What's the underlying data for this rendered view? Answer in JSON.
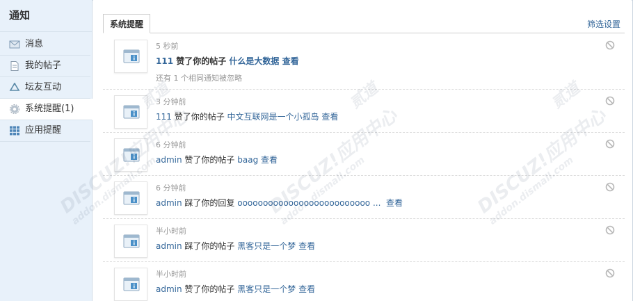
{
  "sidebar": {
    "title": "通知",
    "items": [
      {
        "label": "消息",
        "icon": "envelope-icon",
        "active": false
      },
      {
        "label": "我的帖子",
        "icon": "document-icon",
        "active": false
      },
      {
        "label": "坛友互动",
        "icon": "recycle-icon",
        "active": false
      },
      {
        "label": "系统提醒(1)",
        "icon": "gear-icon",
        "active": true
      },
      {
        "label": "应用提醒",
        "icon": "grid-icon",
        "active": false
      }
    ]
  },
  "main": {
    "tab_label": "系统提醒",
    "filter_label": "筛选设置"
  },
  "notices": [
    {
      "time": "5 秒前",
      "actor": "111",
      "action": " 赞了你的帖子 ",
      "target": "什么是大数据",
      "view": "查看",
      "extra": "还有 1 个相同通知被忽略"
    },
    {
      "time": "3 分钟前",
      "actor": "111",
      "action": " 赞了你的帖子 ",
      "target": "中文互联网是一个小孤岛",
      "view": "查看"
    },
    {
      "time": "6 分钟前",
      "actor": "admin",
      "action": " 赞了你的帖子 ",
      "target": "baag",
      "view": "查看"
    },
    {
      "time": "6 分钟前",
      "actor": "admin",
      "action": " 踩了你的回复 ",
      "target": "oooooooooooooooooooooooooo ...",
      "view": "查看"
    },
    {
      "time": "半小时前",
      "actor": "admin",
      "action": " 踩了你的帖子 ",
      "target": "黑客只是一个梦",
      "view": "查看"
    },
    {
      "time": "半小时前",
      "actor": "admin",
      "action": " 赞了你的帖子 ",
      "target": "黑客只是一个梦",
      "view": "查看"
    }
  ],
  "watermark": {
    "brand": "DISCUZ!应用中心",
    "sub": "addon.dismall.com",
    "mark": "贰道"
  },
  "colors": {
    "sidebar_bg": "#e8f1fa",
    "link": "#336699",
    "muted": "#999999"
  }
}
